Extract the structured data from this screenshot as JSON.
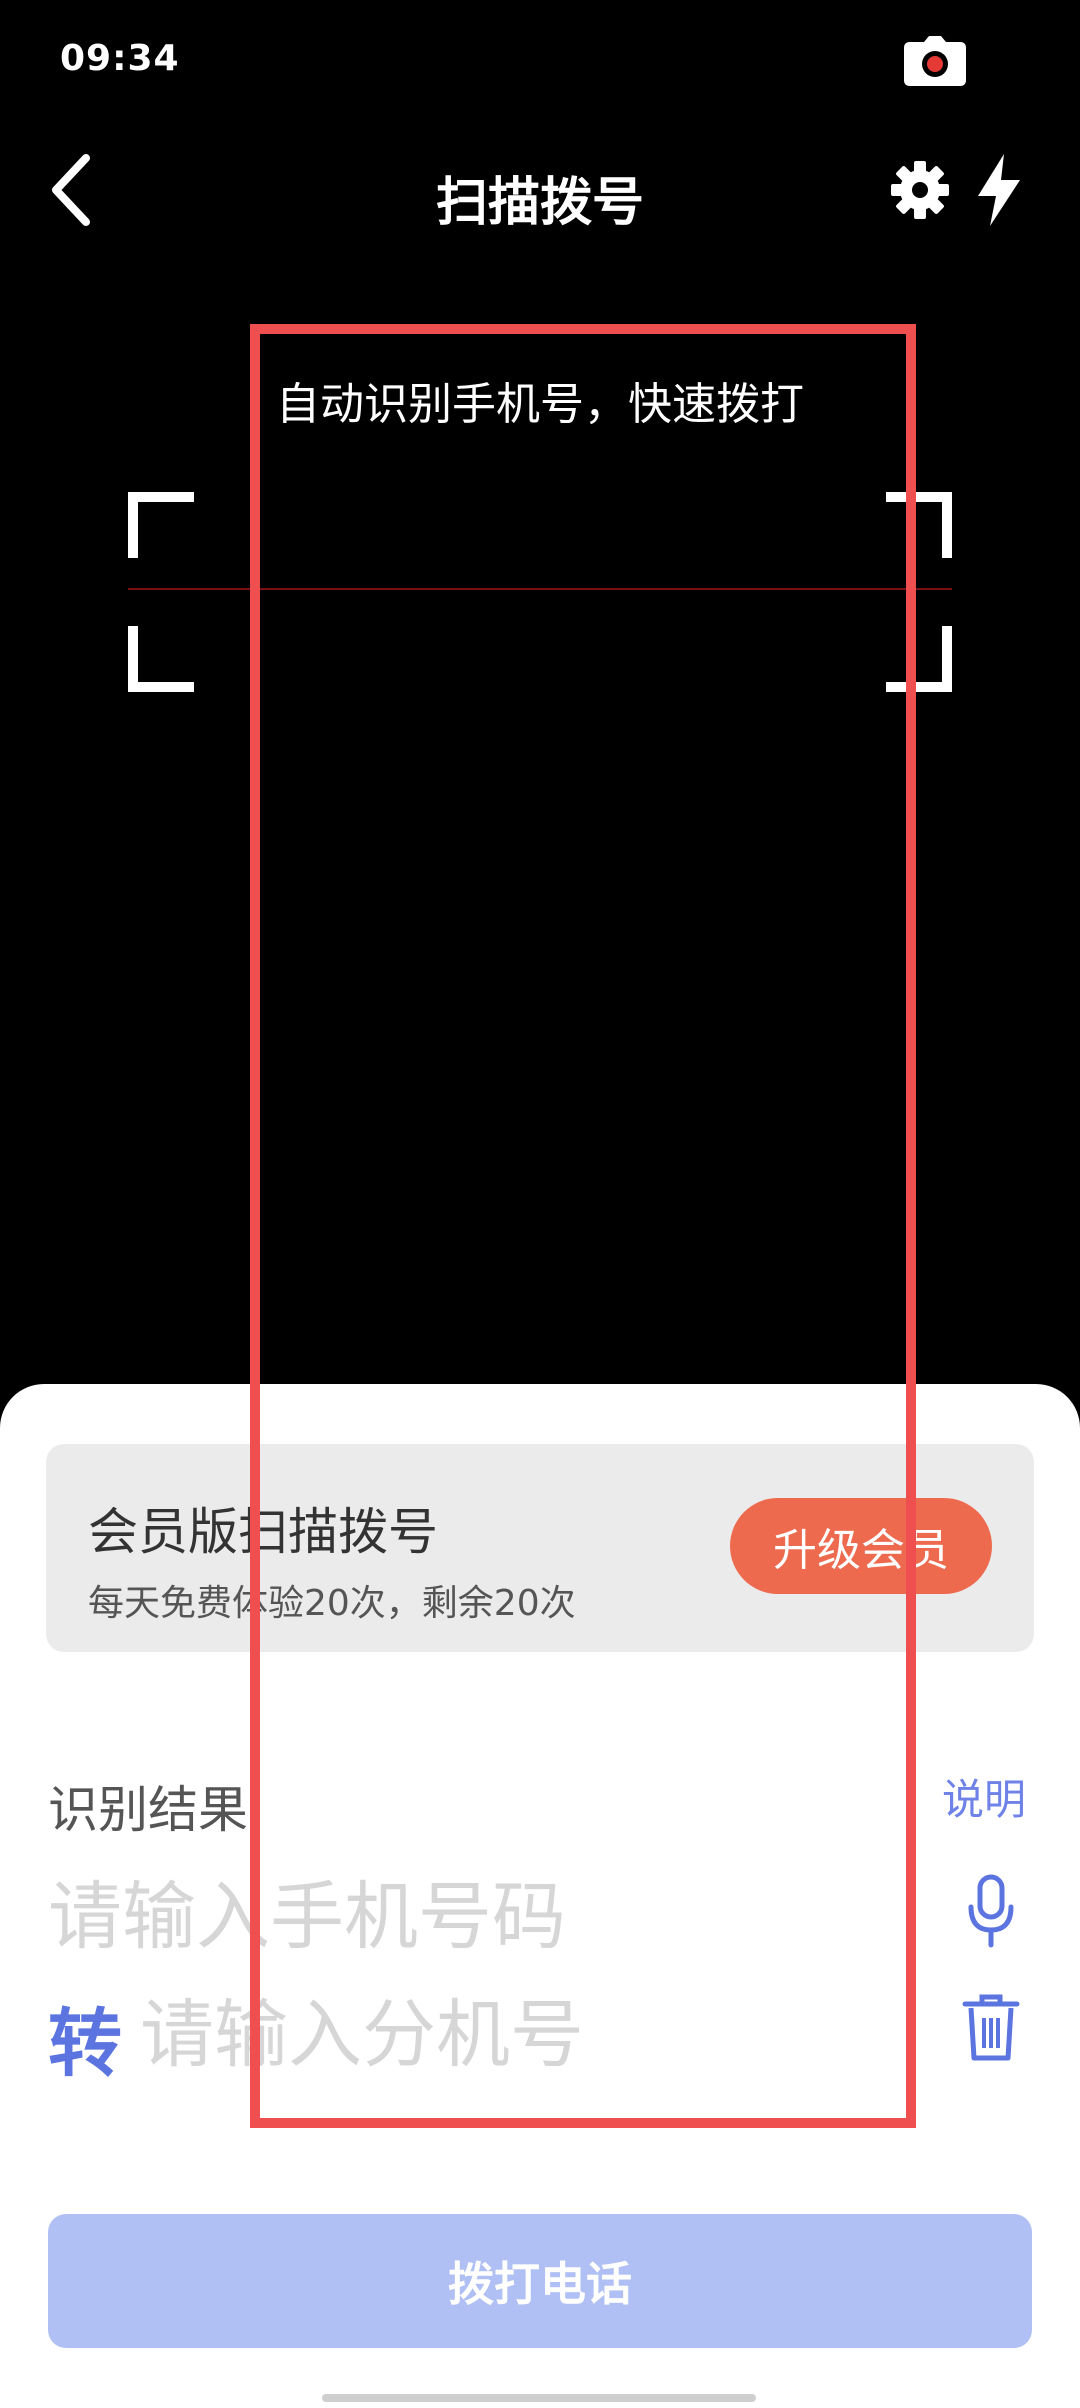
{
  "status_bar": {
    "time": "09:34"
  },
  "header": {
    "title": "扫描拨号"
  },
  "scanner": {
    "hint": "自动识别手机号，快速拨打"
  },
  "vip_card": {
    "title": "会员版扫描拨号",
    "subtitle": "每天免费体验20次，剩余20次",
    "upgrade_label": "升级会员",
    "accent_color": "#ee6a4e"
  },
  "result": {
    "label": "识别结果",
    "explain_link": "说明",
    "phone_placeholder": "请输入手机号码",
    "phone_value": "",
    "transfer_label": "转",
    "extension_placeholder": "请输入分机号",
    "extension_value": ""
  },
  "call_button": {
    "label": "拨打电话",
    "color": "#b0c0f4"
  },
  "icons": [
    "camera-icon",
    "back-arrow-icon",
    "gear-icon",
    "flash-icon",
    "microphone-icon",
    "trash-icon"
  ],
  "overlay": {
    "highlight_color": "#ef4f4f"
  }
}
